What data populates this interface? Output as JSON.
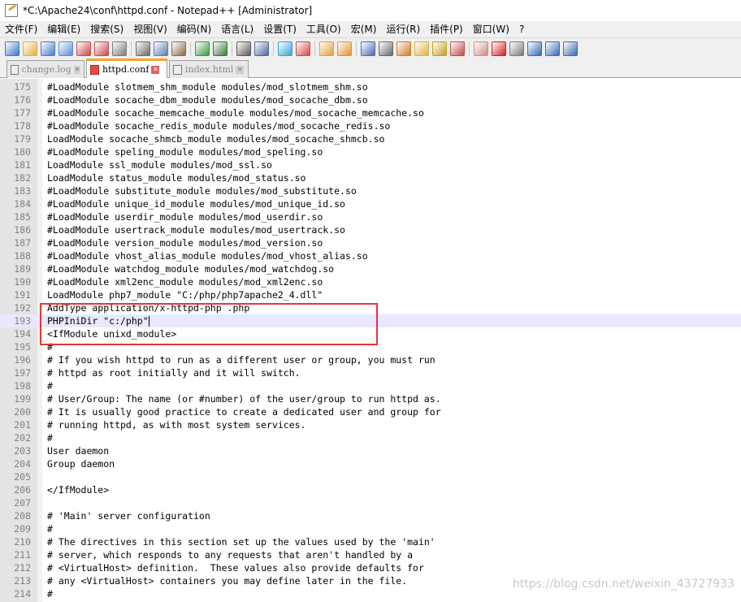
{
  "window": {
    "title": "*C:\\Apache24\\conf\\httpd.conf - Notepad++ [Administrator]"
  },
  "menu": [
    "文件(F)",
    "编辑(E)",
    "搜索(S)",
    "视图(V)",
    "编码(N)",
    "语言(L)",
    "设置(T)",
    "工具(O)",
    "宏(M)",
    "运行(R)",
    "插件(P)",
    "窗口(W)",
    "?"
  ],
  "tabs": [
    {
      "label": "change.log",
      "active": false
    },
    {
      "label": "httpd.conf",
      "active": true
    },
    {
      "label": "index.html",
      "active": false
    }
  ],
  "editor": {
    "current_line": 193,
    "lines": [
      {
        "n": "175",
        "text": "#LoadModule slotmem_shm_module modules/mod_slotmem_shm.so"
      },
      {
        "n": "176",
        "text": "#LoadModule socache_dbm_module modules/mod_socache_dbm.so"
      },
      {
        "n": "177",
        "text": "#LoadModule socache_memcache_module modules/mod_socache_memcache.so"
      },
      {
        "n": "178",
        "text": "#LoadModule socache_redis_module modules/mod_socache_redis.so"
      },
      {
        "n": "179",
        "text": "LoadModule socache_shmcb_module modules/mod_socache_shmcb.so"
      },
      {
        "n": "180",
        "text": "#LoadModule speling_module modules/mod_speling.so"
      },
      {
        "n": "181",
        "text": "LoadModule ssl_module modules/mod_ssl.so"
      },
      {
        "n": "182",
        "text": "LoadModule status_module modules/mod_status.so"
      },
      {
        "n": "183",
        "text": "#LoadModule substitute_module modules/mod_substitute.so"
      },
      {
        "n": "184",
        "text": "#LoadModule unique_id_module modules/mod_unique_id.so"
      },
      {
        "n": "185",
        "text": "#LoadModule userdir_module modules/mod_userdir.so"
      },
      {
        "n": "186",
        "text": "#LoadModule usertrack_module modules/mod_usertrack.so"
      },
      {
        "n": "187",
        "text": "#LoadModule version_module modules/mod_version.so"
      },
      {
        "n": "188",
        "text": "#LoadModule vhost_alias_module modules/mod_vhost_alias.so"
      },
      {
        "n": "189",
        "text": "#LoadModule watchdog_module modules/mod_watchdog.so"
      },
      {
        "n": "190",
        "text": "#LoadModule xml2enc_module modules/mod_xml2enc.so"
      },
      {
        "n": "191",
        "text": "LoadModule php7_module \"C:/php/php7apache2_4.dll\""
      },
      {
        "n": "192",
        "text": "AddType application/x-httpd-php .php"
      },
      {
        "n": "193",
        "text": "PHPIniDir \"c:/php\""
      },
      {
        "n": "194",
        "text": "<IfModule unixd_module>"
      },
      {
        "n": "195",
        "text": "#"
      },
      {
        "n": "196",
        "text": "# If you wish httpd to run as a different user or group, you must run"
      },
      {
        "n": "197",
        "text": "# httpd as root initially and it will switch."
      },
      {
        "n": "198",
        "text": "#"
      },
      {
        "n": "199",
        "text": "# User/Group: The name (or #number) of the user/group to run httpd as."
      },
      {
        "n": "200",
        "text": "# It is usually good practice to create a dedicated user and group for"
      },
      {
        "n": "201",
        "text": "# running httpd, as with most system services."
      },
      {
        "n": "202",
        "text": "#"
      },
      {
        "n": "203",
        "text": "User daemon"
      },
      {
        "n": "204",
        "text": "Group daemon"
      },
      {
        "n": "205",
        "text": ""
      },
      {
        "n": "206",
        "text": "</IfModule>"
      },
      {
        "n": "207",
        "text": ""
      },
      {
        "n": "208",
        "text": "# 'Main' server configuration"
      },
      {
        "n": "209",
        "text": "#"
      },
      {
        "n": "210",
        "text": "# The directives in this section set up the values used by the 'main'"
      },
      {
        "n": "211",
        "text": "# server, which responds to any requests that aren't handled by a"
      },
      {
        "n": "212",
        "text": "# <VirtualHost> definition.  These values also provide defaults for"
      },
      {
        "n": "213",
        "text": "# any <VirtualHost> containers you may define later in the file."
      },
      {
        "n": "214",
        "text": "#"
      }
    ]
  },
  "toolbar_icons": [
    "new-file-icon",
    "open-file-icon",
    "save-icon",
    "save-all-icon",
    "close-icon",
    "close-all-icon",
    "print-icon",
    "cut-icon",
    "copy-icon",
    "paste-icon",
    "undo-icon",
    "redo-icon",
    "find-icon",
    "replace-icon",
    "zoom-in-icon",
    "zoom-out-icon",
    "sync-v-icon",
    "sync-h-icon",
    "word-wrap-icon",
    "show-all-chars-icon",
    "indent-guide-icon",
    "doc-map-icon",
    "function-list-icon",
    "folder-workspace-icon",
    "monitor-icon",
    "record-macro-icon",
    "stop-macro-icon",
    "play-macro-icon",
    "run-macro-multiple-icon",
    "save-macro-icon"
  ],
  "watermark": "https://blog.csdn.net/weixin_43727933",
  "colors": {
    "highlight_border": "#e8363a",
    "active_tab_accent": "#f5a623"
  }
}
